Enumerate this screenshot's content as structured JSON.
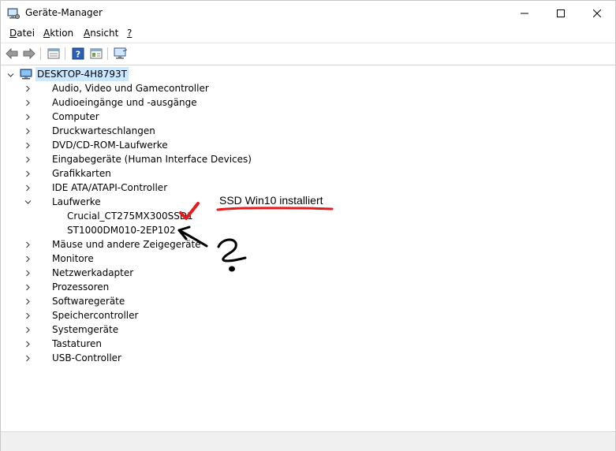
{
  "window": {
    "title": "Geräte-Manager"
  },
  "menu": [
    {
      "label": "Datei"
    },
    {
      "label": "Aktion"
    },
    {
      "label": "Ansicht"
    },
    {
      "label": "?"
    }
  ],
  "tree": {
    "root": "DESKTOP-4H8793T",
    "categories": [
      {
        "label": "Audio, Video und Gamecontroller",
        "icon": "speaker-icon"
      },
      {
        "label": "Audioeingänge und -ausgänge",
        "icon": "speaker-icon"
      },
      {
        "label": "Computer",
        "icon": "monitor-icon"
      },
      {
        "label": "Druckwarteschlangen",
        "icon": "printer-icon"
      },
      {
        "label": "DVD/CD-ROM-Laufwerke",
        "icon": "disc-icon"
      },
      {
        "label": "Eingabegeräte (Human Interface Devices)",
        "icon": "hid-icon"
      },
      {
        "label": "Grafikkarten",
        "icon": "display-adapter-icon"
      },
      {
        "label": "IDE ATA/ATAPI-Controller",
        "icon": "controller-icon"
      },
      {
        "label": "Laufwerke",
        "icon": "drive-icon",
        "expanded": true
      },
      {
        "label": "Mäuse und andere Zeigegeräte",
        "icon": "mouse-icon"
      },
      {
        "label": "Monitore",
        "icon": "monitor-icon"
      },
      {
        "label": "Netzwerkadapter",
        "icon": "network-icon"
      },
      {
        "label": "Prozessoren",
        "icon": "cpu-icon"
      },
      {
        "label": "Softwaregeräte",
        "icon": "software-device-icon"
      },
      {
        "label": "Speichercontroller",
        "icon": "storage-controller-icon"
      },
      {
        "label": "Systemgeräte",
        "icon": "system-device-icon"
      },
      {
        "label": "Tastaturen",
        "icon": "keyboard-icon"
      },
      {
        "label": "USB-Controller",
        "icon": "usb-icon"
      }
    ],
    "drives": [
      {
        "label": "Crucial_CT275MX300SSD1"
      },
      {
        "label": "ST1000DM010-2EP102"
      }
    ]
  },
  "annotation": {
    "text": "SSD  Win10 installiert",
    "question_mark": "?",
    "ink_color": "#e8191a"
  }
}
